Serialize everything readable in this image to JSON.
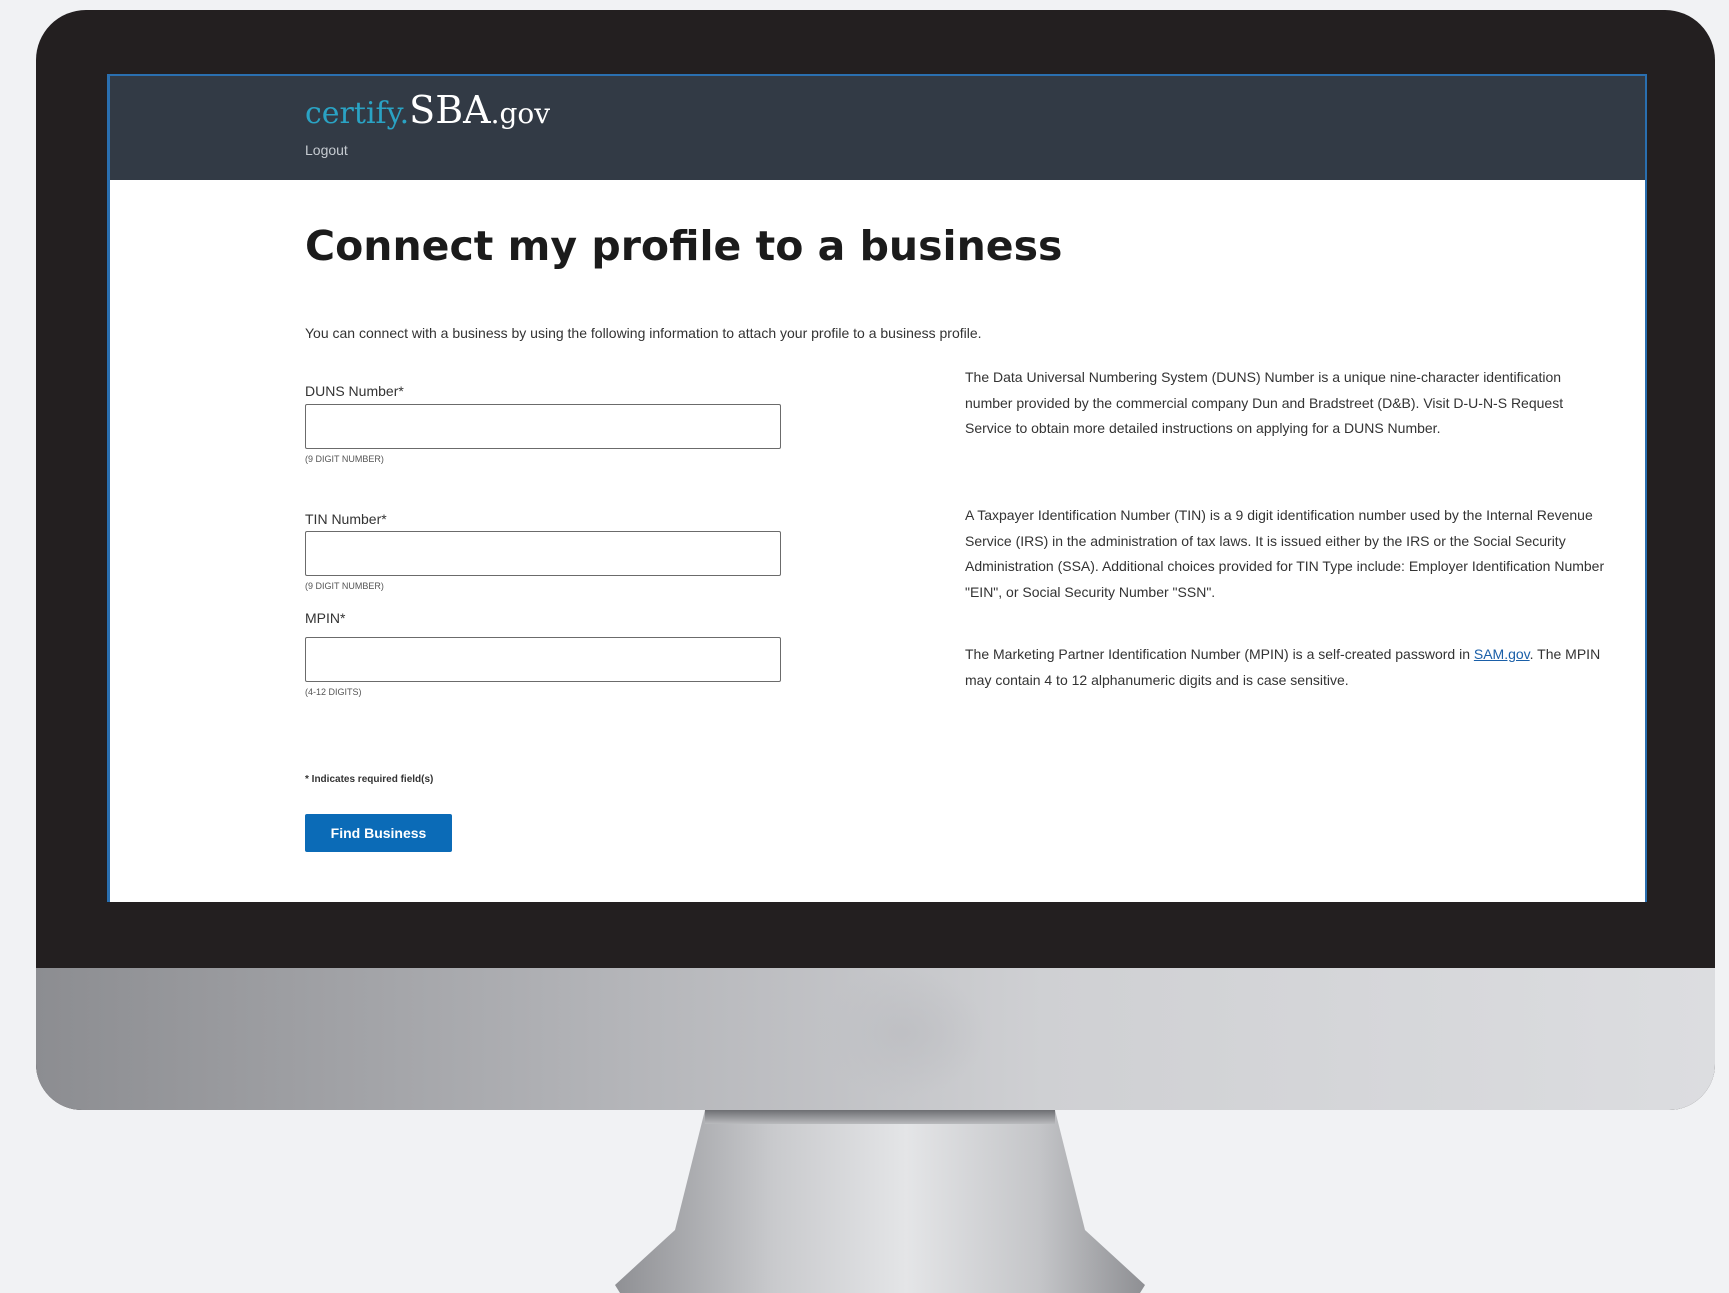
{
  "header": {
    "logo_certify": "certify.",
    "logo_sba": "SBA",
    "logo_gov": ".gov",
    "logout": "Logout"
  },
  "page": {
    "title": "Connect my profile to a business",
    "intro": "You can connect with a business by using the following information to attach your profile to a business profile."
  },
  "form": {
    "duns": {
      "label": "DUNS Number*",
      "value": "",
      "hint": "(9 DIGIT NUMBER)"
    },
    "tin": {
      "label": "TIN Number*",
      "value": "",
      "hint": "(9 DIGIT NUMBER)"
    },
    "mpin": {
      "label": "MPIN*",
      "value": "",
      "hint": "(4-12 DIGITS)"
    },
    "required_note": "* Indicates required field(s)",
    "submit_label": "Find Business"
  },
  "info": {
    "duns": "The Data Universal Numbering System (DUNS) Number is a unique nine-character identification number provided by the commercial company Dun and Bradstreet (D&B). Visit D-U-N-S Request Service to obtain more detailed instructions on applying for a DUNS Number.",
    "tin": "A Taxpayer Identification Number (TIN) is a 9 digit identification number used by the Internal Revenue Service (IRS) in the administration of tax laws. It is issued either by the IRS or the Social Security Administration (SSA). Additional choices provided for TIN Type include: Employer Identification Number \"EIN\", or Social Security Number \"SSN\".",
    "mpin_before": "The Marketing Partner Identification Number (MPIN) is a self-created password in ",
    "mpin_link": "SAM.gov",
    "mpin_after": ". The MPIN may contain 4 to 12 alphanumeric digits and is case sensitive."
  },
  "colors": {
    "header_bg": "#323a45",
    "accent_link": "#2aa3c4",
    "button_bg": "#0b6bb7"
  }
}
